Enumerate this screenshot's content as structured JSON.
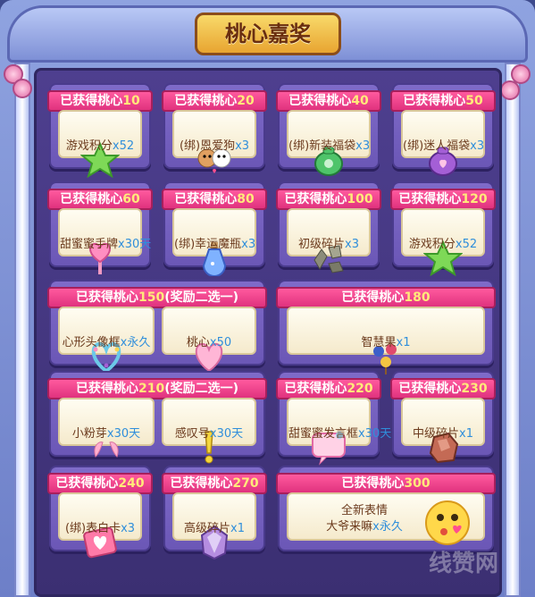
{
  "title": "桃心嘉奖",
  "rewards": [
    {
      "prefix": "已获得桃心",
      "points": "10",
      "note": "",
      "name": "游戏积分",
      "qty": "x52",
      "icon": "green-star-icon"
    },
    {
      "prefix": "已获得桃心",
      "points": "20",
      "note": "",
      "name": "(绑)恩爱狗",
      "qty": "x3",
      "icon": "couple-dogs-icon"
    },
    {
      "prefix": "已获得桃心",
      "points": "40",
      "note": "",
      "name": "(绑)新装福袋",
      "qty": "x3",
      "icon": "green-lucky-bag-icon"
    },
    {
      "prefix": "已获得桃心",
      "points": "50",
      "note": "",
      "name": "(绑)迷人福袋",
      "qty": "x3",
      "icon": "purple-lucky-bag-icon"
    },
    {
      "prefix": "已获得桃心",
      "points": "60",
      "note": "",
      "name": "甜蜜蜜手牌",
      "qty": "x30天",
      "icon": "heart-sign-icon"
    },
    {
      "prefix": "已获得桃心",
      "points": "80",
      "note": "",
      "name": "(绑)幸运魔瓶",
      "qty": "x3",
      "icon": "magic-bottle-icon"
    },
    {
      "prefix": "已获得桃心",
      "points": "100",
      "note": "",
      "name": "初级碎片",
      "qty": "x3",
      "icon": "stone-fragments-icon"
    },
    {
      "prefix": "已获得桃心",
      "points": "120",
      "note": "",
      "name": "游戏积分",
      "qty": "x52",
      "icon": "green-star-icon"
    },
    {
      "prefix": "已获得桃心",
      "points": "150",
      "note": "(奖励二选一)",
      "name": "心形头像框",
      "qty": "x永久",
      "name2": "桃心",
      "qty2": "x50",
      "icon": "heart-frame-icon",
      "icon2": "peach-heart-icon"
    },
    {
      "prefix": "已获得桃心",
      "points": "180",
      "note": "",
      "name": "智慧果",
      "qty": "x1",
      "icon": "wisdom-fruit-icon"
    },
    {
      "prefix": "已获得桃心",
      "points": "210",
      "note": "(奖励二选一)",
      "name": "小粉芽",
      "qty": "x30天",
      "name2": "感叹号",
      "qty2": "x30天",
      "icon": "pink-sprout-icon",
      "icon2": "exclamation-icon"
    },
    {
      "prefix": "已获得桃心",
      "points": "220",
      "note": "",
      "name": "甜蜜蜜发言框",
      "qty": "x30天",
      "icon": "chat-bubble-frame-icon"
    },
    {
      "prefix": "已获得桃心",
      "points": "230",
      "note": "",
      "name": "中级碎片",
      "qty": "x1",
      "icon": "red-stone-icon"
    },
    {
      "prefix": "已获得桃心",
      "points": "240",
      "note": "",
      "name": "(绑)表白卡",
      "qty": "x3",
      "icon": "love-card-icon"
    },
    {
      "prefix": "已获得桃心",
      "points": "270",
      "note": "",
      "name": "高级碎片",
      "qty": "x1",
      "icon": "purple-crystal-icon"
    },
    {
      "prefix": "已获得桃心",
      "points": "300",
      "note": "",
      "name": "全新表情",
      "line2": "大爷来嘛",
      "qty": "x永久",
      "icon": "kiss-emoji-icon"
    }
  ],
  "watermark": "线赞网"
}
